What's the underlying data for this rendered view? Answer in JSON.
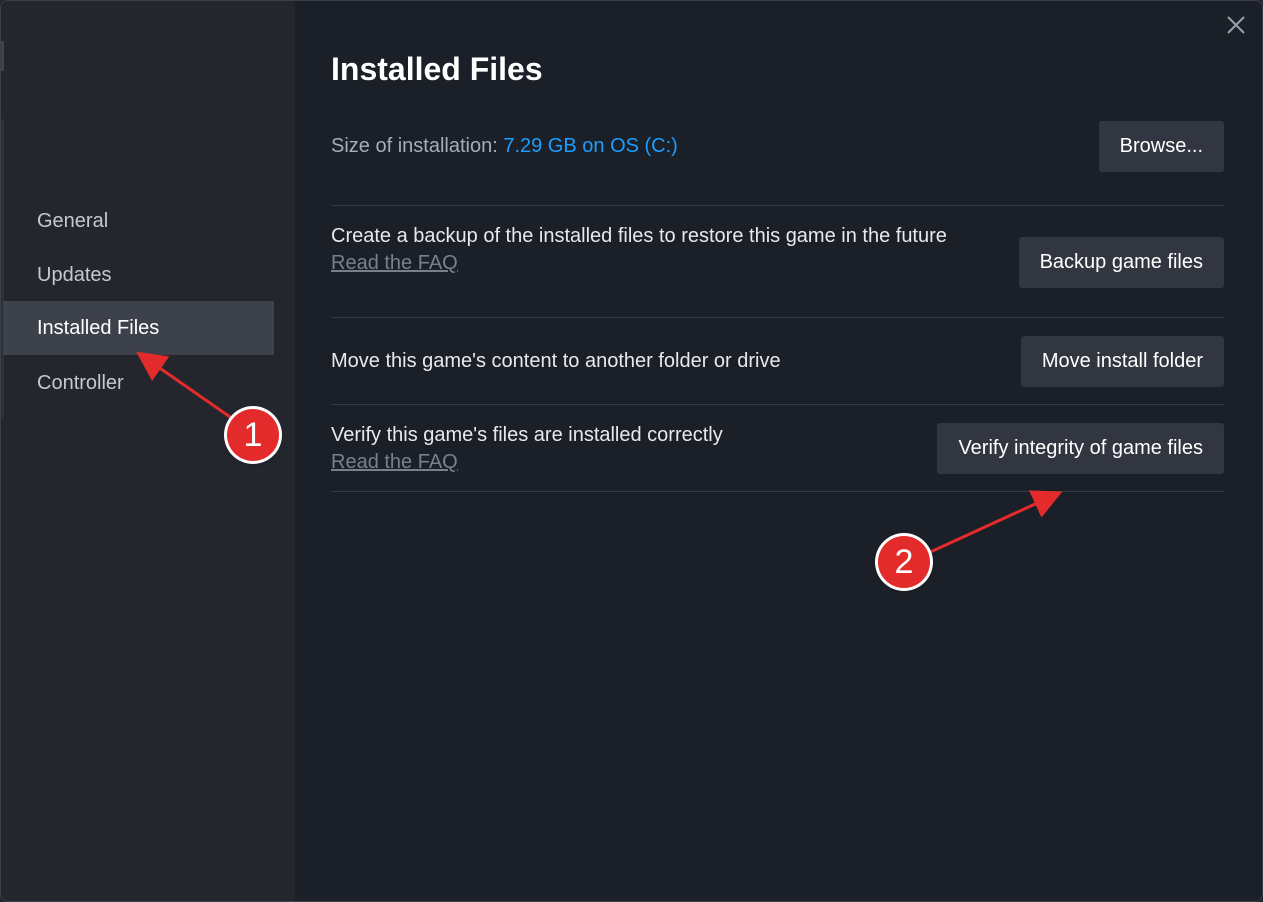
{
  "sidebar": {
    "items": [
      {
        "label": "General",
        "active": false
      },
      {
        "label": "Updates",
        "active": false
      },
      {
        "label": "Installed Files",
        "active": true
      },
      {
        "label": "Controller",
        "active": false
      }
    ]
  },
  "main": {
    "title": "Installed Files",
    "size_label": "Size of installation:",
    "size_value": "7.29 GB on OS (C:)",
    "browse_label": "Browse...",
    "backup": {
      "text": "Create a backup of the installed files to restore this game in the future",
      "faq": "Read the FAQ",
      "button": "Backup game files"
    },
    "move": {
      "text": "Move this game's content to another folder or drive",
      "button": "Move install folder"
    },
    "verify": {
      "text": "Verify this game's files are installed correctly",
      "faq": "Read the FAQ",
      "button": "Verify integrity of game files"
    }
  },
  "annotations": {
    "badge_1": "1",
    "badge_2": "2",
    "color": "#e32b2b"
  },
  "icons": {
    "close": "close-icon"
  },
  "colors": {
    "accent": "#1a9fff",
    "background": "#1b1f27",
    "sidebar": "#23262d",
    "button": "#313640"
  }
}
